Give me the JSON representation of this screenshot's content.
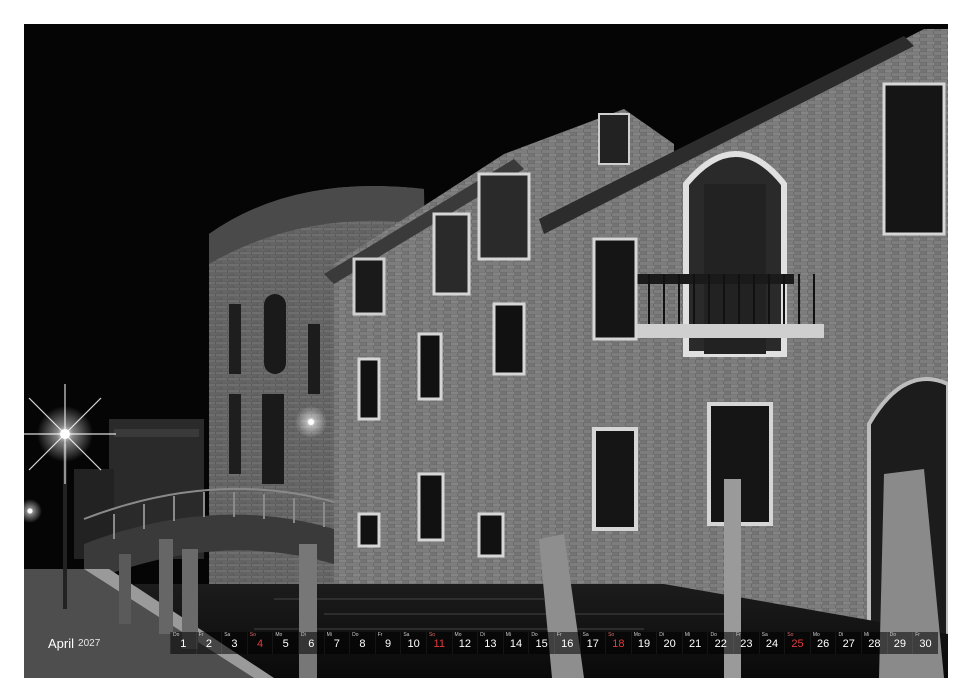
{
  "calendar": {
    "month": "April",
    "year": "2027",
    "days": [
      {
        "wd": "Do",
        "n": "1",
        "sun": false
      },
      {
        "wd": "Fr",
        "n": "2",
        "sun": false
      },
      {
        "wd": "Sa",
        "n": "3",
        "sun": false
      },
      {
        "wd": "So",
        "n": "4",
        "sun": true
      },
      {
        "wd": "Mo",
        "n": "5",
        "sun": false
      },
      {
        "wd": "Di",
        "n": "6",
        "sun": false
      },
      {
        "wd": "Mi",
        "n": "7",
        "sun": false
      },
      {
        "wd": "Do",
        "n": "8",
        "sun": false
      },
      {
        "wd": "Fr",
        "n": "9",
        "sun": false
      },
      {
        "wd": "Sa",
        "n": "10",
        "sun": false
      },
      {
        "wd": "So",
        "n": "11",
        "sun": true
      },
      {
        "wd": "Mo",
        "n": "12",
        "sun": false
      },
      {
        "wd": "Di",
        "n": "13",
        "sun": false
      },
      {
        "wd": "Mi",
        "n": "14",
        "sun": false
      },
      {
        "wd": "Do",
        "n": "15",
        "sun": false
      },
      {
        "wd": "Fr",
        "n": "16",
        "sun": false
      },
      {
        "wd": "Sa",
        "n": "17",
        "sun": false
      },
      {
        "wd": "So",
        "n": "18",
        "sun": true
      },
      {
        "wd": "Mo",
        "n": "19",
        "sun": false
      },
      {
        "wd": "Di",
        "n": "20",
        "sun": false
      },
      {
        "wd": "Mi",
        "n": "21",
        "sun": false
      },
      {
        "wd": "Do",
        "n": "22",
        "sun": false
      },
      {
        "wd": "Fr",
        "n": "23",
        "sun": false
      },
      {
        "wd": "Sa",
        "n": "24",
        "sun": false
      },
      {
        "wd": "So",
        "n": "25",
        "sun": true
      },
      {
        "wd": "Mo",
        "n": "26",
        "sun": false
      },
      {
        "wd": "Di",
        "n": "27",
        "sun": false
      },
      {
        "wd": "Mi",
        "n": "28",
        "sun": false
      },
      {
        "wd": "Do",
        "n": "29",
        "sun": false
      },
      {
        "wd": "Fr",
        "n": "30",
        "sun": false
      }
    ]
  },
  "colors": {
    "sunday": "#e33a3a",
    "photo_bg": "#050505"
  }
}
